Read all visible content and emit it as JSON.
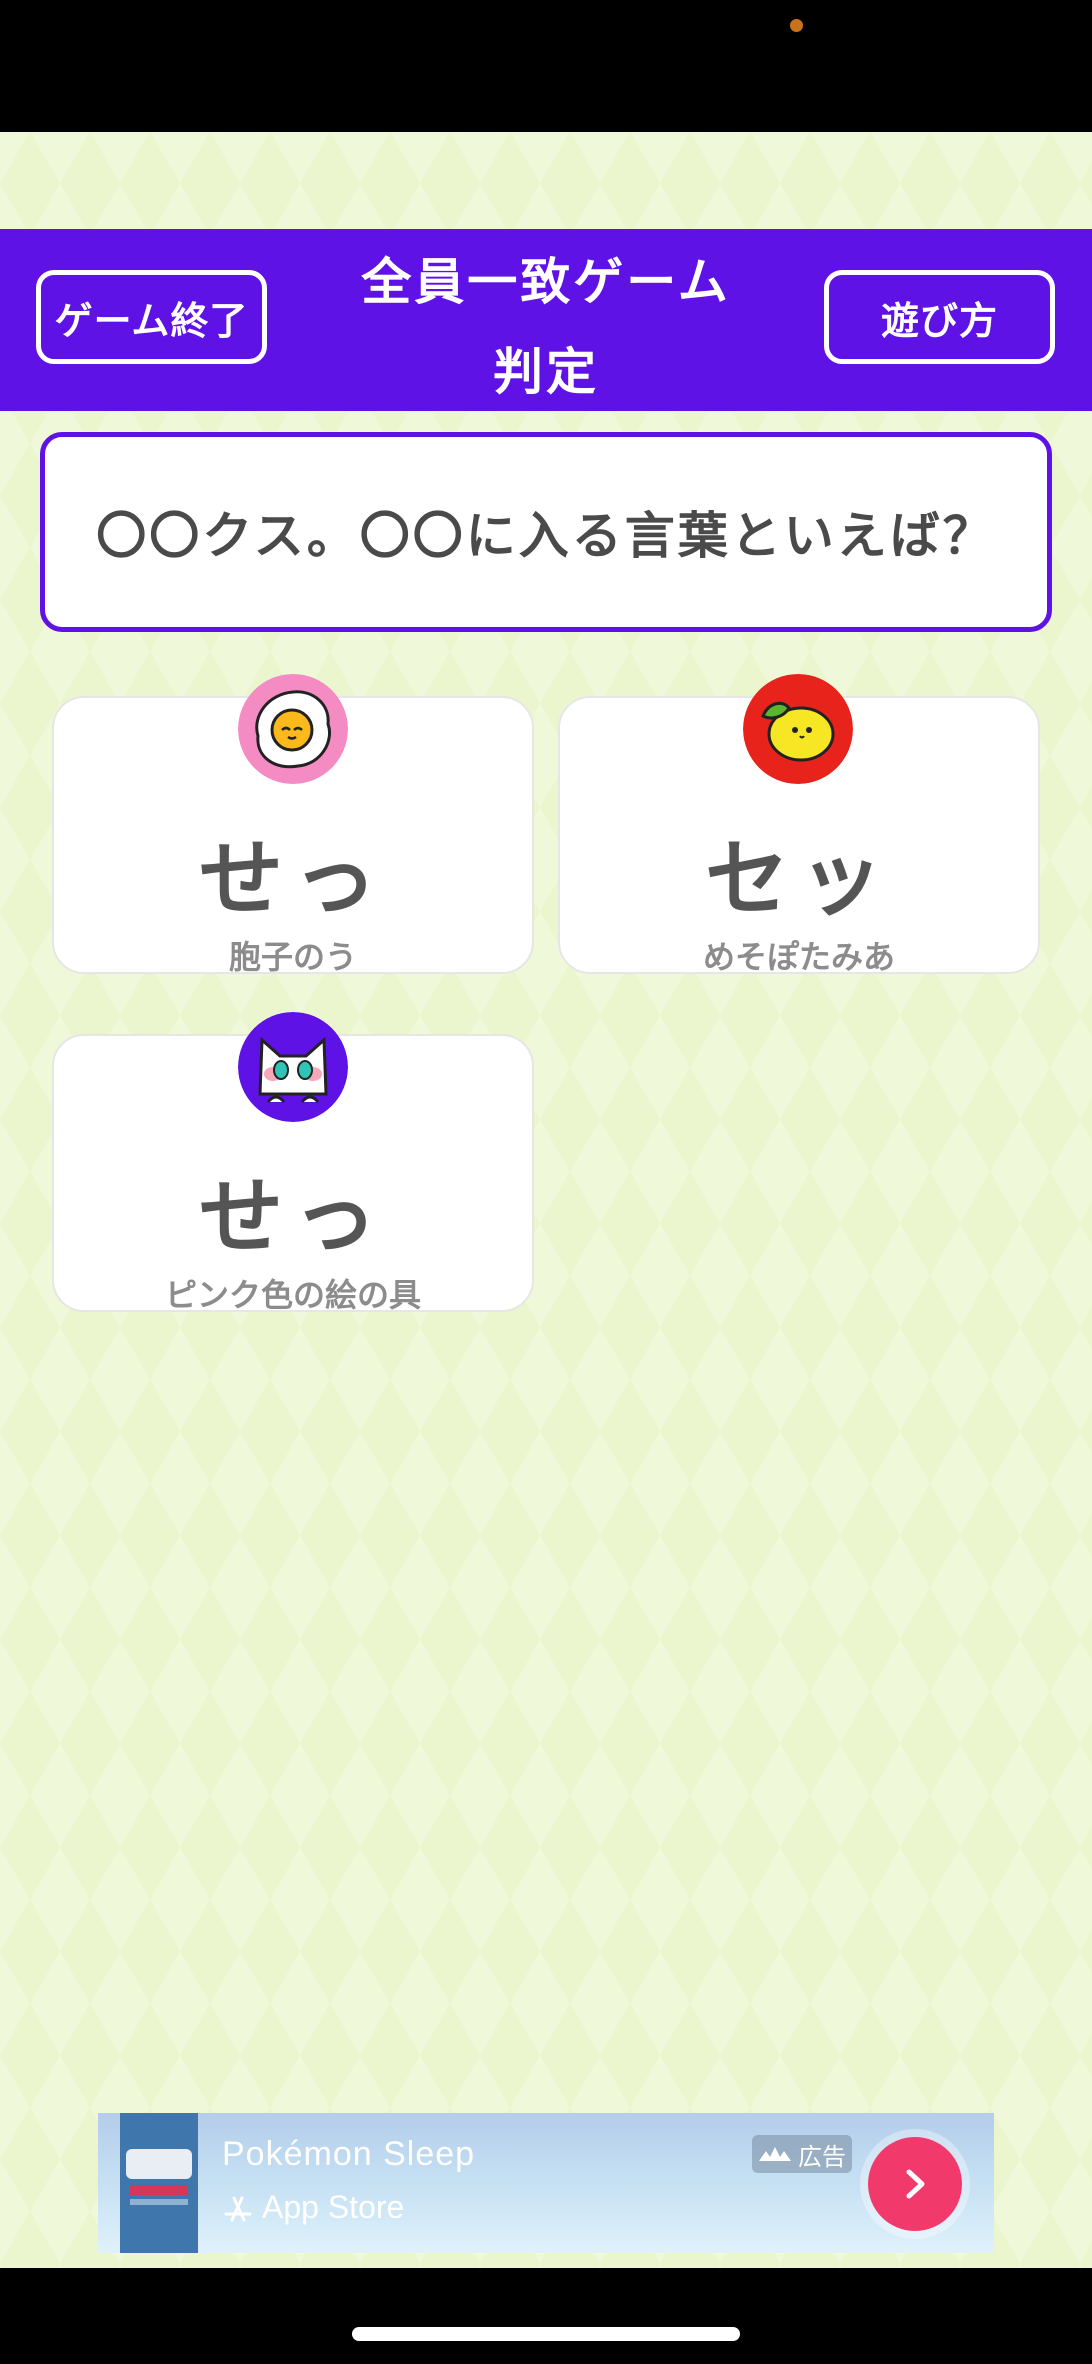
{
  "header": {
    "end_label": "ゲーム終了",
    "title_line1": "全員一致ゲーム",
    "title_line2": "判定",
    "howto_label": "遊び方"
  },
  "question": "〇〇クス。〇〇に入る言葉といえば？",
  "answers": [
    {
      "answer": "せっ",
      "player": "胞子のう",
      "avatar_icon": "fried-egg-icon",
      "avatar_color": "#f48bc3"
    },
    {
      "answer": "セッ",
      "player": "めそぽたみあ",
      "avatar_icon": "lemon-icon",
      "avatar_color": "#e8231c"
    },
    {
      "answer": "せっ",
      "player": "ピンク色の絵の具",
      "avatar_icon": "cat-icon",
      "avatar_color": "#5e12e6"
    }
  ],
  "ad": {
    "title": "Pokémon Sleep",
    "store": "App Store",
    "badge": "広告"
  },
  "colors": {
    "accent": "#5e12e6",
    "background": "#ebf6cf",
    "cta": "#f2396b"
  }
}
